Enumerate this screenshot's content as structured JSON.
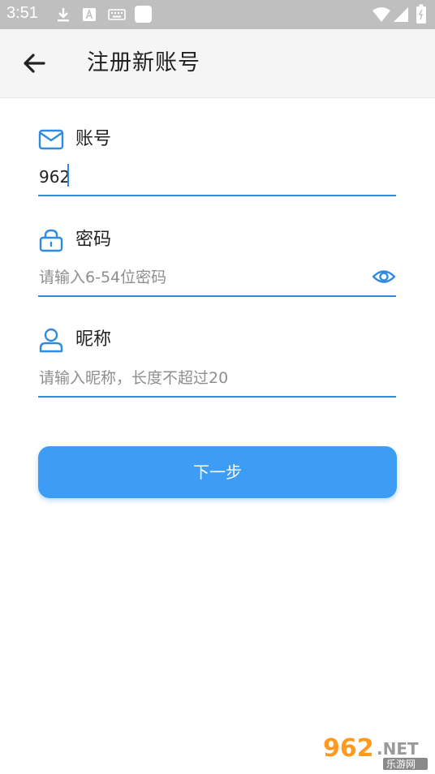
{
  "status_bar": {
    "time": "3:51",
    "icons": [
      "download-icon",
      "text-a-icon",
      "keyboard-icon",
      "notification-square-icon",
      "wifi-icon",
      "signal-icon",
      "battery-icon"
    ]
  },
  "app_bar": {
    "back_icon": "arrow-left-icon",
    "title": "注册新账号"
  },
  "form": {
    "account": {
      "icon": "mail-icon",
      "label": "账号",
      "value": "962"
    },
    "password": {
      "icon": "lock-icon",
      "label": "密码",
      "placeholder": "请输入6-54位密码",
      "toggle_icon": "eye-icon"
    },
    "nickname": {
      "icon": "user-icon",
      "label": "昵称",
      "placeholder": "请输入昵称，长度不超过20"
    }
  },
  "next_button": {
    "label": "下一步"
  },
  "watermark": {
    "brand": "962",
    "domain": ".NET",
    "caption": "乐游网"
  },
  "colors": {
    "accent": "#2f8ae0",
    "button": "#3d9cf3",
    "status_bar": "#bfbfbf",
    "app_bar": "#f5f5f5"
  }
}
